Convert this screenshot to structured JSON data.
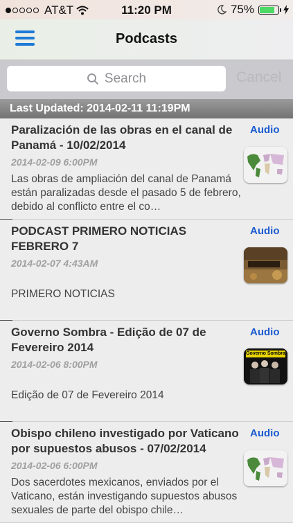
{
  "status": {
    "time": "11:20 PM",
    "carrier": "AT&T",
    "battery": "75%"
  },
  "nav": {
    "title": "Podcasts"
  },
  "search": {
    "placeholder": "Search",
    "cancel": "Cancel"
  },
  "last_updated": "Last Updated: 2014-02-11 11:19PM",
  "items": [
    {
      "title": "Paralización de las obras en el canal de Panamá - 10/02/2014",
      "date": "2014-02-09 6:00PM",
      "desc": "Las obras de ampliación del canal de Panamá están paralizadas desde el pasado 5 de febrero, debido al conflicto entre el co…",
      "audio": "Audio",
      "thumb": "world-map"
    },
    {
      "title": "PODCAST PRIMERO NOTICIAS FEBRERO 7",
      "date": "2014-02-07 4:43AM",
      "desc": "PRIMERO NOTICIAS",
      "audio": "Audio",
      "thumb": "podcast"
    },
    {
      "title": "Governo Sombra - Edição de 07 de Fevereiro 2014",
      "date": "2014-02-06 8:00PM",
      "desc": "Edição de 07 de Fevereiro 2014",
      "audio": "Audio",
      "thumb": "governo-sombra",
      "thumb_text": "Governo Sombra"
    },
    {
      "title": "Obispo chileno investigado por Vaticano por supuestos abusos - 07/02/2014",
      "date": "2014-02-06 6:00PM",
      "desc": "Dos sacerdotes mexicanos, enviados por el Vaticano, están investigando supuestos abusos sexuales de parte del obispo chile…",
      "audio": "Audio",
      "thumb": "world-map"
    }
  ]
}
